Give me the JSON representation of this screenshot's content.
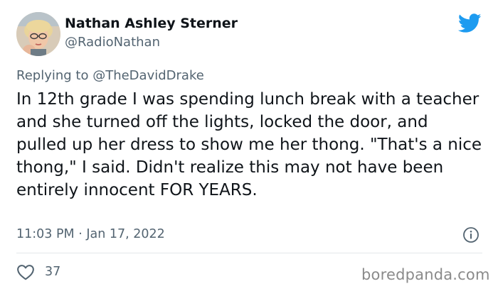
{
  "author": {
    "display_name": "Nathan Ashley Sterner",
    "handle": "@RadioNathan"
  },
  "reply": {
    "prefix": "Replying to ",
    "mention": "@TheDavidDrake"
  },
  "tweet": {
    "text": "In 12th grade I was spending lunch break with a teacher and she turned off the lights, locked the door, and pulled up her dress to show me her thong. \"That's a nice thong,\" I said. Didn't realize this may not have been entirely innocent FOR YEARS.",
    "timestamp": "11:03 PM · Jan 17, 2022"
  },
  "engagement": {
    "likes": "37"
  },
  "watermark": "boredpanda.com",
  "icons": {
    "brand": "twitter-bird-icon",
    "info": "info-icon",
    "like": "heart-icon"
  },
  "colors": {
    "twitter_blue": "#1d9bf0",
    "secondary_text": "#536471",
    "primary_text": "#0f1419",
    "divider": "#e3e7ea"
  }
}
